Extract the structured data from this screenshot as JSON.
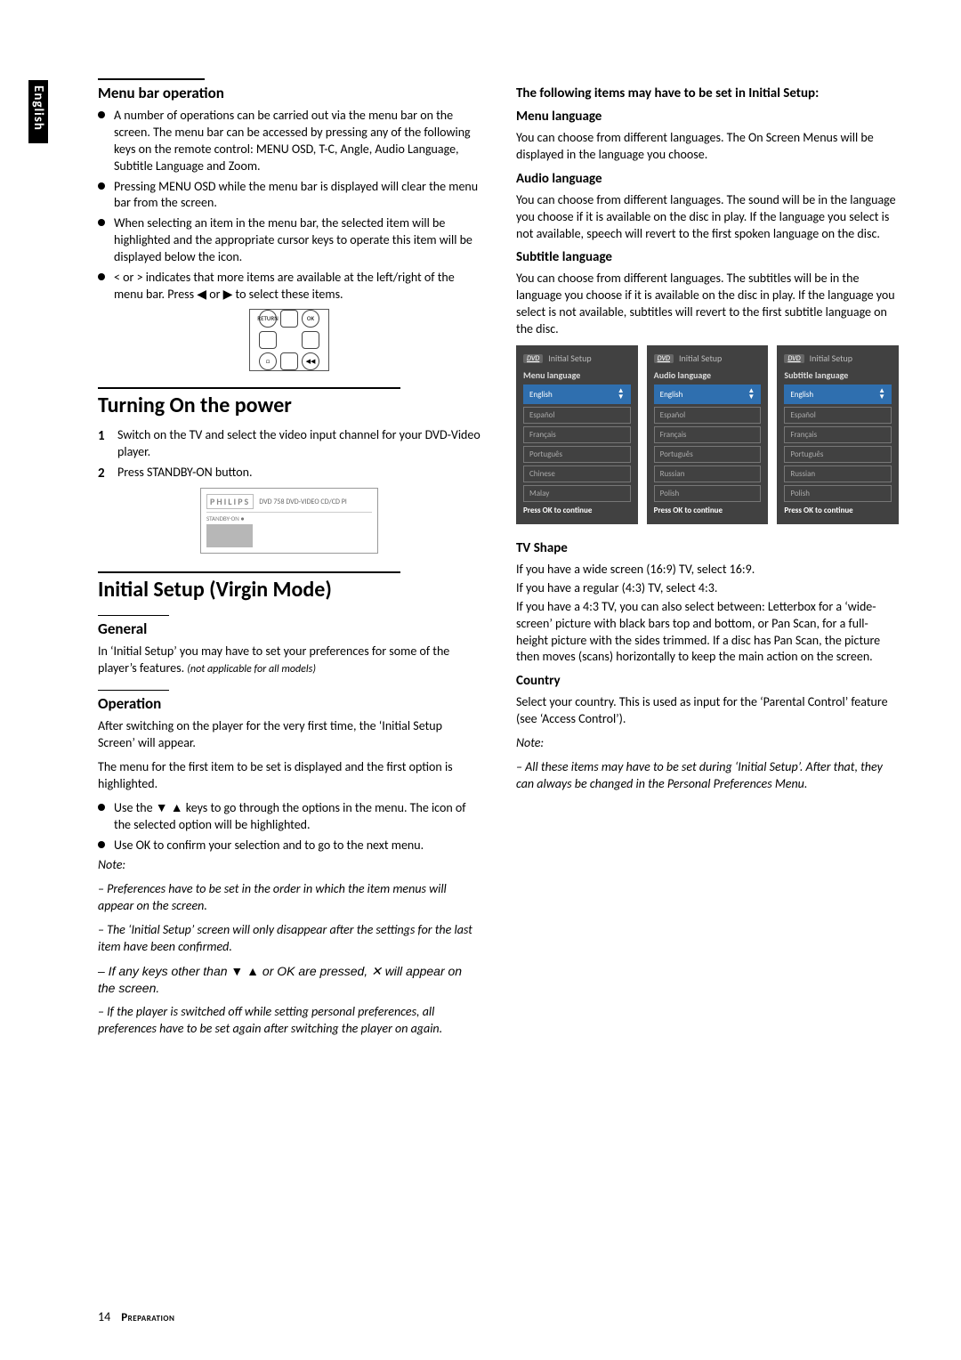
{
  "sideTab": "English",
  "left": {
    "menuBar": {
      "title": "Menu bar operation",
      "bullets": [
        "A number of operations can be carried out via the menu bar on the screen. The menu bar can be accessed by pressing any of the following keys on the remote control: MENU OSD, T-C, Angle, Audio Language, Subtitle Language and Zoom.",
        "Pressing MENU OSD while the menu bar is displayed will clear the menu bar from the screen.",
        "When selecting an item in the menu bar, the selected item will be highlighted and the appropriate cursor keys to operate this item will be displayed below the icon.",
        "< or > indicates that more items are available at the left/right of the menu bar. Press ◀ or ▶ to select these items."
      ],
      "keypad": {
        "tl": "RETURN",
        "tr": "OK",
        "bl": "□",
        "br": "◀◀"
      }
    },
    "power": {
      "title": "Turning On the power",
      "steps": [
        "Switch on the TV and select the video input channel for your DVD-Video player.",
        "Press STANDBY-ON button."
      ],
      "panel": {
        "brand": "PHILIPS",
        "model": "DVD 758 DVD-VIDEO CD/CD Pl",
        "standby": "STANDBY-ON ●"
      }
    },
    "setup": {
      "title": "Initial Setup (Virgin Mode)",
      "general": {
        "head": "General",
        "body": "In ‘Initial Setup’ you may have to set your preferences for some of the player’s features.",
        "note": "(not applicable for all models)"
      },
      "operation": {
        "head": "Operation",
        "p1": "After switching on the player for the very first time, the ‘Initial Setup Screen’ will appear.",
        "p2": "The menu for the first item to be set is displayed and the first option is highlighted.",
        "bullets": [
          "Use the ▼ ▲ keys to go through the options in the menu. The icon of the selected option will be highlighted.",
          "Use OK to confirm your selection and to go to the next menu."
        ],
        "noteHead": "Note:",
        "notes": [
          "–  Preferences have to be set in the order in which the item menus will appear on the screen.",
          "–  The ‘Initial Setup’ screen will only disappear after the settings for the last item have been confirmed.",
          "–  If any keys other than ▼ ▲ or OK are pressed, ✕ will appear on the screen.",
          "–  If the player is switched off while setting personal preferences, all preferences have to be set again after switching the player on again."
        ]
      }
    }
  },
  "right": {
    "intro": "The following items may have to be set in Initial Setup:",
    "menuLang": {
      "head": "Menu language",
      "body": "You can choose from different languages. The On Screen Menus will be displayed in the language you choose."
    },
    "audioLang": {
      "head": "Audio language",
      "body": "You can choose from different languages. The sound will be in the language you choose if it is available on the disc in play. If the language you select is not available, speech will revert to the first spoken language on the disc."
    },
    "subLang": {
      "head": "Subtitle language",
      "body": "You can choose from different languages. The subtitles will be in the language you choose if it is available on the disc in play. If the language you select is not available, subtitles will revert to the first subtitle language on the disc."
    },
    "screens": {
      "dvd": "DVD",
      "initTitle": "Initial Setup",
      "cont": "Press OK to continue",
      "a": {
        "sub": "Menu language",
        "opts": [
          "English",
          "Español",
          "Français",
          "Português",
          "Chinese",
          "Malay"
        ]
      },
      "b": {
        "sub": "Audio language",
        "opts": [
          "English",
          "Español",
          "Français",
          "Português",
          "Russian",
          "Polish"
        ]
      },
      "c": {
        "sub": "Subtitle language",
        "opts": [
          "English",
          "Español",
          "Français",
          "Português",
          "Russian",
          "Polish"
        ]
      }
    },
    "tvShape": {
      "head": "TV Shape",
      "l1": "If you have a wide screen (16:9) TV, select 16:9.",
      "l2": "If you have a regular (4:3) TV, select 4:3.",
      "l3": "If you have a 4:3 TV, you can also select between: Letterbox for a ‘wide-screen’ picture with black bars top and bottom, or Pan Scan, for a full-height picture with the sides trimmed. If a disc has Pan Scan, the picture then moves (scans) horizontally to keep the main action on the screen."
    },
    "country": {
      "head": "Country",
      "body": "Select your country. This is used as input for the ‘Parental Control’ feature (see ‘Access Control’)."
    },
    "noteHead": "Note:",
    "note": "–  All these items may have to be set during ‘Initial Setup’. After that, they can always be changed in the Personal Preferences Menu."
  },
  "footer": {
    "page": "14",
    "section": "Preparation"
  }
}
